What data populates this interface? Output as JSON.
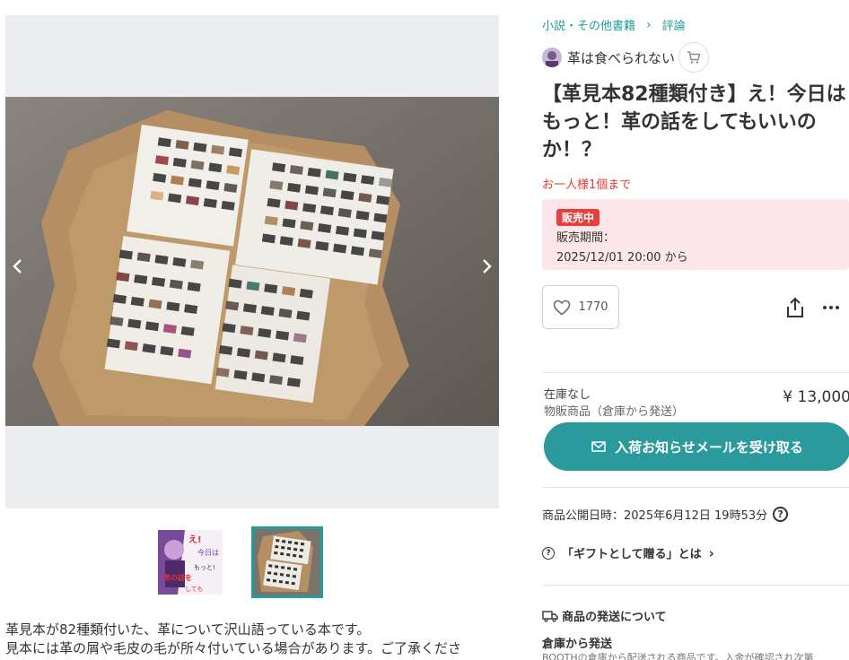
{
  "gallery": {
    "prev_icon": "chevron-left-icon",
    "next_icon": "chevron-right-icon",
    "selected_index": 2
  },
  "thumbnails": [
    {
      "alt": "表紙"
    },
    {
      "alt": "革見本"
    }
  ],
  "cover_text": {
    "line1": "え!",
    "line2": "今日は",
    "line3": "もっと!",
    "line4": "革の話を",
    "line5": "しても"
  },
  "description": {
    "line1": "革見本が82種類付いた、革について沢山語っている本です。",
    "line2": "見本には革の屑や毛皮の毛が所々付いている場合があります。ご了承くださ"
  },
  "breadcrumb": {
    "category": "小説・その他書籍",
    "subcategory": "評論"
  },
  "shop": {
    "name": "革は食べられない",
    "cart_icon": "cart-icon"
  },
  "product": {
    "title": "【革見本82種類付き】え！今日はもっと！革の話をしてもいいのか！？",
    "limit": "お一人様1個まで"
  },
  "sale": {
    "badge": "販売中",
    "period_label": "販売期間：",
    "period_value": "2025/12/01 20:00 から"
  },
  "actions": {
    "like_count": "1770",
    "like_icon": "heart-icon",
    "share_icon": "share-icon",
    "more_icon": "more-horizontal-icon"
  },
  "stock": {
    "status": "在庫なし",
    "shipping_type": "物販商品（倉庫から発送）",
    "price": "¥ 13,000"
  },
  "notify": {
    "label": "入荷お知らせメールを受け取る",
    "icon": "mail-icon"
  },
  "published": {
    "text": "商品公開日時：2025年6月12日 19時53分",
    "help_icon": "question-icon"
  },
  "gift": {
    "label": "「ギフトとして贈る」とは"
  },
  "shipping": {
    "heading": "商品の発送について",
    "warehouse_title": "倉庫から発送",
    "warehouse_desc": "BOOTHの倉庫から配送される商品です。入金が確認され次第"
  },
  "colors": {
    "accent": "#2a9a9c",
    "sale_bg": "#fde6ea",
    "badge": "#e5403f",
    "limit": "#e8382c"
  }
}
